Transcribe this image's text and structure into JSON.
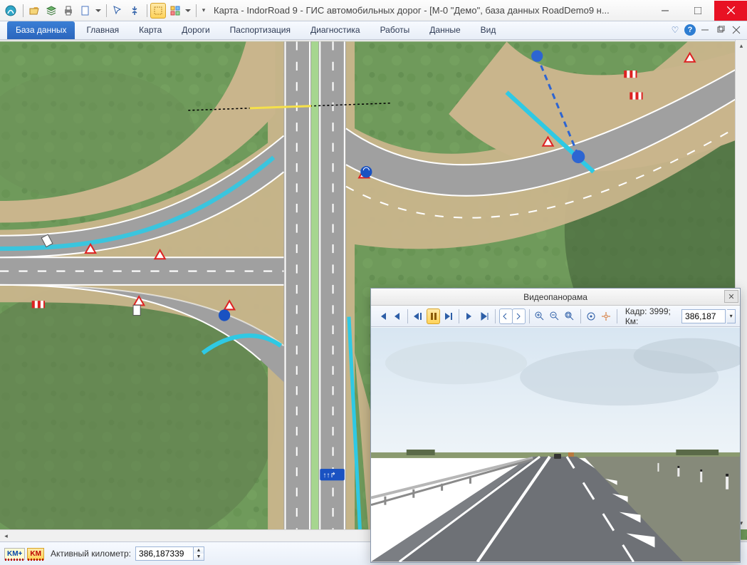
{
  "title": "Карта - IndorRoad 9 - ГИС автомобильных дорог - [М-0 \"Демо\", база данных RoadDemo9 н...",
  "tabs": {
    "active": "База данных",
    "items": [
      "База данных",
      "Главная",
      "Карта",
      "Дороги",
      "Паспортизация",
      "Диагностика",
      "Работы",
      "Данные",
      "Вид"
    ]
  },
  "status": {
    "active_km_label": "Активный километр:",
    "active_km_value": "386,187339"
  },
  "video_panel": {
    "title": "Видеопанорама",
    "frame_label": "Кадр: 3999; Км:",
    "km_value": "386,187"
  },
  "toolbar_icons": [
    "app",
    "folder",
    "layers",
    "print",
    "new",
    "dropdown",
    "measure",
    "route",
    "highlight",
    "grid",
    "dropdown2"
  ]
}
